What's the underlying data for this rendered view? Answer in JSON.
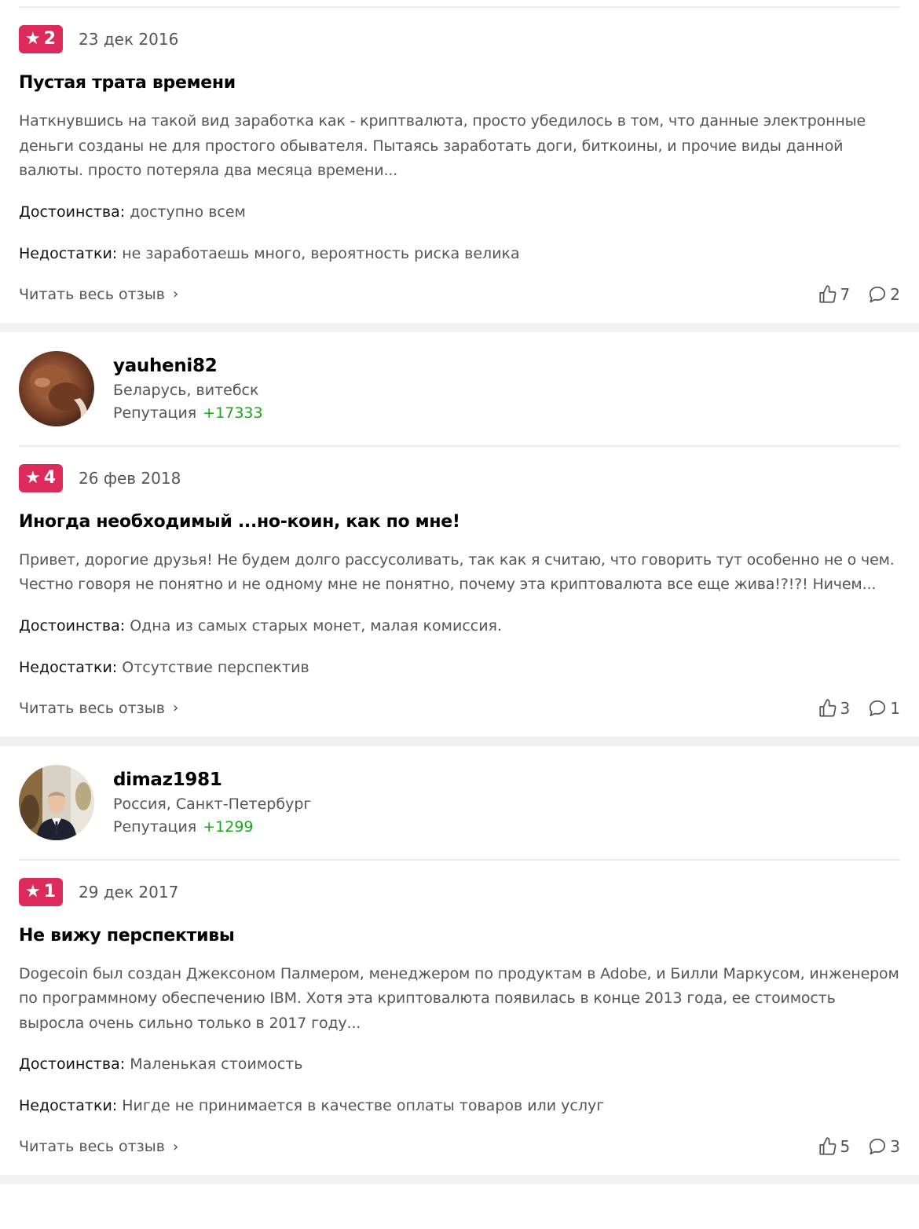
{
  "reviews": [
    {
      "rating": "2",
      "date": "23 дек 2016",
      "title": "Пустая трата времени",
      "excerpt": "Наткнувшись на такой вид заработка как - криптвалюта, просто убедилось в том, что данные электронные деньги созданы не для простого обывателя. Пытаясь заработать доги, биткоины, и прочие виды данной валюты. просто потеряла два месяца времени...",
      "pros_label": "Достоинства:",
      "pros": "доступно всем",
      "cons_label": "Недостатки:",
      "cons": "не заработаешь много, вероятность риска велика",
      "read_more": "Читать весь отзыв",
      "likes": "7",
      "comments": "2"
    },
    {
      "user": {
        "name": "yauheni82",
        "location": "Беларусь, витебск",
        "reputation_label": "Репутация",
        "reputation": "+17333"
      },
      "rating": "4",
      "date": "26 фев 2018",
      "title": "Иногда необходимый ...но-коин, как по мне!",
      "excerpt": "Привет, дорогие друзья! Не будем долго рассусоливать, так как я считаю, что говорить тут особенно не о чем. Честно говоря не понятно и не одному мне не понятно, почему эта криптовалюта все еще жива!?!?! Ничем...",
      "pros_label": "Достоинства:",
      "pros": "Одна из самых старых монет, малая комиссия.",
      "cons_label": "Недостатки:",
      "cons": "Отсутствие перспектив",
      "read_more": "Читать весь отзыв",
      "likes": "3",
      "comments": "1"
    },
    {
      "user": {
        "name": "dimaz1981",
        "location": "Россия, Санкт-Петербург",
        "reputation_label": "Репутация",
        "reputation": "+1299"
      },
      "rating": "1",
      "date": "29 дек 2017",
      "title": "Не вижу перспективы",
      "excerpt": "Dogecoin был создан Джексоном Палмером, менеджером по продуктам в Adobe, и Билли Маркусом, инженером по программному обеспечению IBM. Хотя эта криптовалюта появилась в конце 2013 года, ее стоимость выросла очень сильно только в 2017 году...",
      "pros_label": "Достоинства:",
      "pros": "Маленькая стоимость",
      "cons_label": "Недостатки:",
      "cons": "Нигде не принимается в качестве оплаты товаров или услуг",
      "read_more": "Читать весь отзыв",
      "likes": "5",
      "comments": "3"
    }
  ],
  "icons": {
    "star": "star-icon",
    "chevron": "chevron-right-icon",
    "like": "thumbs-up-icon",
    "comment": "comment-icon"
  },
  "colors": {
    "badge": "#dc2a5a",
    "reputation": "#1aa51a",
    "separator": "#f0f1f3"
  }
}
